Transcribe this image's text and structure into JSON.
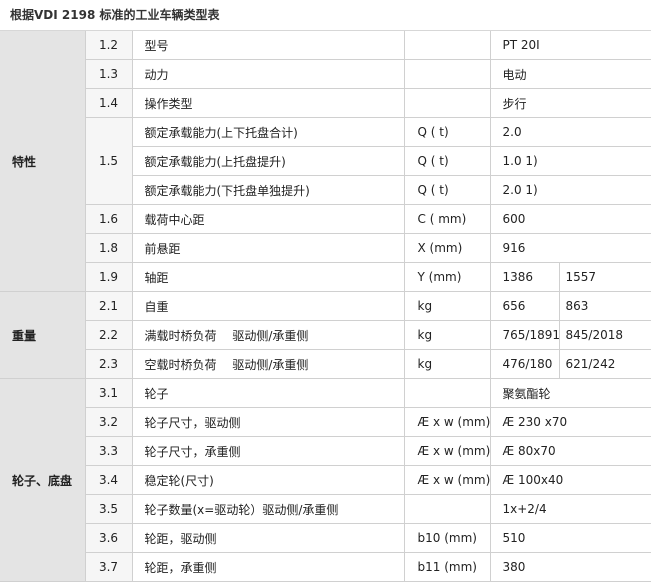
{
  "title": "根据VDI 2198 标准的工业车辆类型表",
  "groups": {
    "g1": "特性",
    "g2": "重量",
    "g3": "轮子、底盘"
  },
  "rows": [
    {
      "code": "1.2",
      "param": "型号",
      "unit": "",
      "val": "PT 20I",
      "val2": ""
    },
    {
      "code": "1.3",
      "param": "动力",
      "unit": "",
      "val": "电动",
      "val2": ""
    },
    {
      "code": "1.4",
      "param": "操作类型",
      "unit": "",
      "val": "步行",
      "val2": ""
    },
    {
      "code": "1.5",
      "param": "额定承载能力(上下托盘合计)",
      "unit": "Q ( t)",
      "val": "2.0",
      "val2": ""
    },
    {
      "code": "",
      "param": "额定承载能力(上托盘提升)",
      "unit": "Q ( t)",
      "val": "1.0 1)",
      "val2": ""
    },
    {
      "code": "",
      "param": "额定承载能力(下托盘单独提升)",
      "unit": "Q ( t)",
      "val": "2.0 1)",
      "val2": ""
    },
    {
      "code": "1.6",
      "param": "载荷中心距",
      "unit": "C ( mm)",
      "val": "600",
      "val2": ""
    },
    {
      "code": "1.8",
      "param": "前悬距",
      "unit": "X (mm)",
      "val": "916",
      "val2": ""
    },
    {
      "code": "1.9",
      "param": "轴距",
      "unit": "Y (mm)",
      "val": "1386",
      "val2": "1557"
    },
    {
      "code": "2.1",
      "param": "自重",
      "unit": "kg",
      "val": "656",
      "val2": "863"
    },
    {
      "code": "2.2",
      "param": "满载时桥负荷　 驱动侧/承重侧",
      "unit": "kg",
      "val": "765/1891",
      "val2": "845/2018"
    },
    {
      "code": "2.3",
      "param": "空载时桥负荷　 驱动侧/承重侧",
      "unit": "kg",
      "val": "476/180",
      "val2": "621/242"
    },
    {
      "code": "3.1",
      "param": "轮子",
      "unit": "",
      "val": "聚氨酯轮",
      "val2": ""
    },
    {
      "code": "3.2",
      "param": "轮子尺寸，驱动侧",
      "unit": "Æ x w (mm)",
      "val": "Æ 230 x70",
      "val2": ""
    },
    {
      "code": "3.3",
      "param": "轮子尺寸，承重侧",
      "unit": "Æ x w (mm)",
      "val": "Æ 80x70",
      "val2": ""
    },
    {
      "code": "3.4",
      "param": "稳定轮(尺寸)",
      "unit": "Æ x w (mm)",
      "val": "Æ 100x40",
      "val2": ""
    },
    {
      "code": "3.5",
      "param": "轮子数量(x=驱动轮）驱动侧/承重侧",
      "unit": "",
      "val": "1x+2/4",
      "val2": ""
    },
    {
      "code": "3.6",
      "param": "轮距，驱动侧",
      "unit": "b10 (mm)",
      "val": "510",
      "val2": ""
    },
    {
      "code": "3.7",
      "param": "轮距，承重侧",
      "unit": "b11 (mm)",
      "val": "380",
      "val2": ""
    }
  ]
}
